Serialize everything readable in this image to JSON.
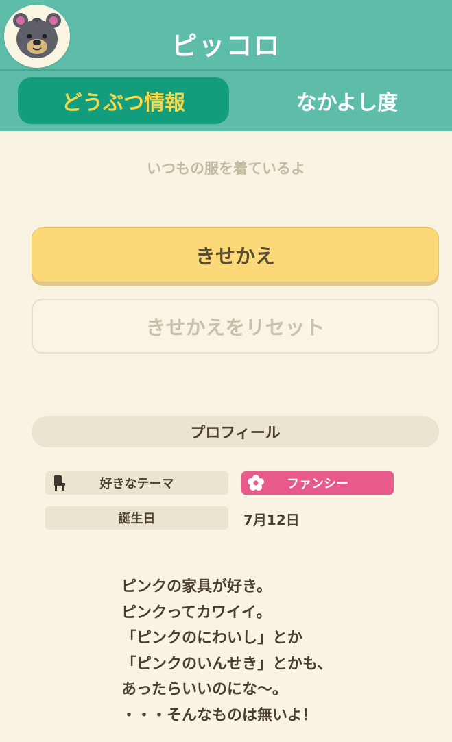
{
  "header": {
    "villager_name": "ピッコロ",
    "avatar_icon": "bear-villager-icon"
  },
  "tabs": [
    {
      "label": "どうぶつ情報",
      "active": true
    },
    {
      "label": "なかよし度",
      "active": false
    }
  ],
  "outfit": {
    "status": "いつもの服を着ているよ",
    "dress_button": "きせかえ",
    "reset_button": "きせかえをリセット"
  },
  "profile": {
    "heading": "プロフィール",
    "theme_label": "好きなテーマ",
    "theme_icon": "chair-icon",
    "theme_value": "ファンシー",
    "theme_value_icon": "flower-icon",
    "birthday_label": "誕生日",
    "birthday_value": "7月12日"
  },
  "quote": {
    "lines": [
      "ピンクの家具が好き。",
      "ピンクってカワイイ。",
      "「ピンクのにわいし」とか",
      "「ピンクのいんせき」とかも、",
      "あったらいいのにな〜。",
      "・・・そんなものは無いよ！"
    ]
  },
  "colors": {
    "header_teal": "#5dbda8",
    "active_tab": "#129d7d",
    "active_tab_text": "#f3d84b",
    "button_yellow": "#fcd978",
    "theme_pink": "#e85a8c",
    "background": "#f8f3e3"
  }
}
